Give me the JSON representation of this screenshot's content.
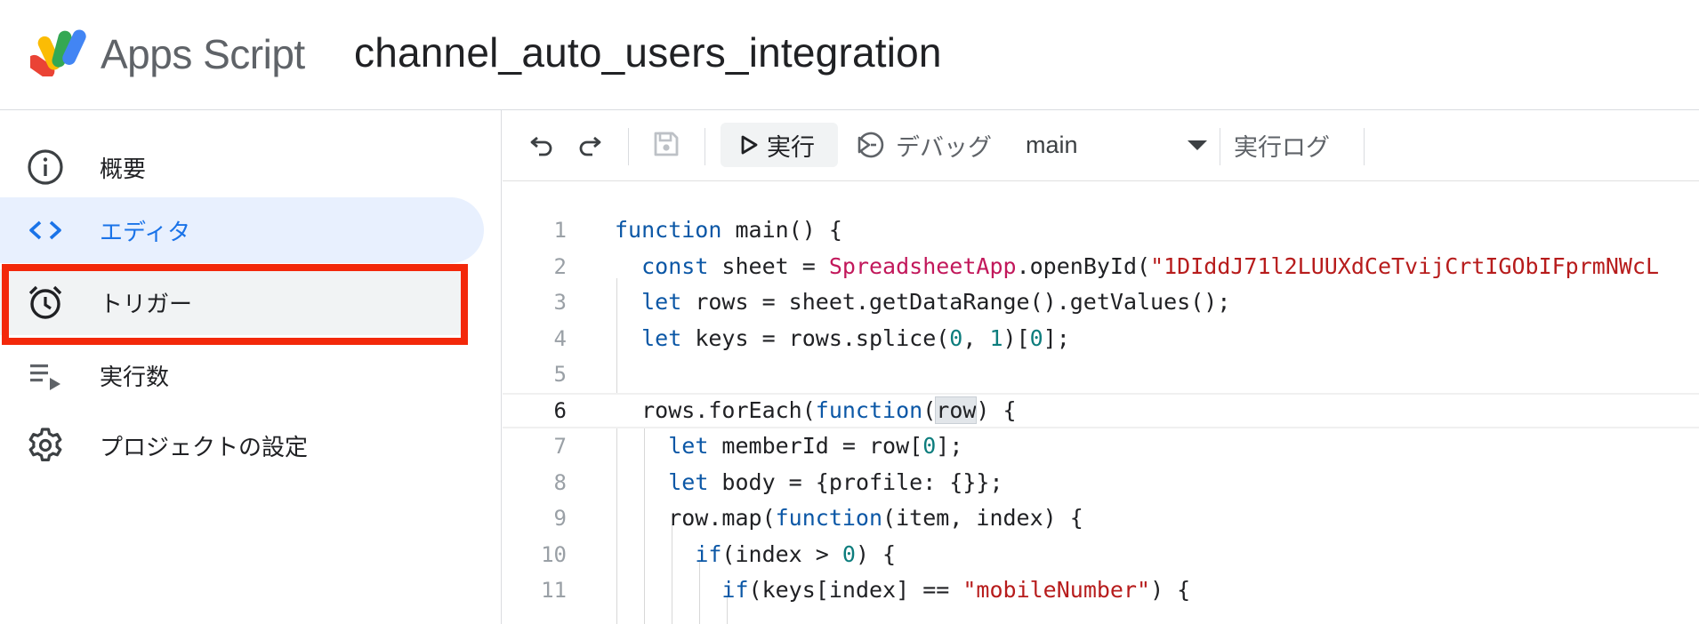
{
  "header": {
    "brand": "Apps Script",
    "project_title": "channel_auto_users_integration",
    "logo_colors": [
      "#4285f4",
      "#34a853",
      "#fbbc04",
      "#ea4335"
    ]
  },
  "sidebar": {
    "items": [
      {
        "label": "概要",
        "icon": "info-icon"
      },
      {
        "label": "エディタ",
        "icon": "code-brackets-icon",
        "active": true
      },
      {
        "label": "トリガー",
        "icon": "alarm-clock-icon",
        "highlighted": true
      },
      {
        "label": "実行数",
        "icon": "executions-list-icon"
      },
      {
        "label": "プロジェクトの設定",
        "icon": "gear-icon"
      }
    ],
    "callout_color": "#f3280a"
  },
  "toolbar": {
    "undo_icon": "undo-icon",
    "redo_icon": "redo-icon",
    "save_icon": "save-icon",
    "run_label": "実行",
    "debug_label": "デバッグ",
    "function_selected": "main",
    "log_label": "実行ログ"
  },
  "editor": {
    "current_line": 6,
    "lines": [
      {
        "n": "1",
        "text": "function main() {"
      },
      {
        "n": "2",
        "text": "  const sheet = SpreadsheetApp.openById(\"1DIddJ71l2LUUXdCeTvijCrtIGObIFprmNWcL"
      },
      {
        "n": "3",
        "text": "  let rows = sheet.getDataRange().getValues();"
      },
      {
        "n": "4",
        "text": "  let keys = rows.splice(0, 1)[0];"
      },
      {
        "n": "5",
        "text": ""
      },
      {
        "n": "6",
        "text": "  rows.forEach(function(row) {"
      },
      {
        "n": "7",
        "text": "    let memberId = row[0];"
      },
      {
        "n": "8",
        "text": "    let body = {profile: {}};"
      },
      {
        "n": "9",
        "text": "    row.map(function(item, index) {"
      },
      {
        "n": "10",
        "text": "      if(index > 0) {"
      },
      {
        "n": "11",
        "text": "        if(keys[index] == \"mobileNumber\") {"
      }
    ]
  }
}
